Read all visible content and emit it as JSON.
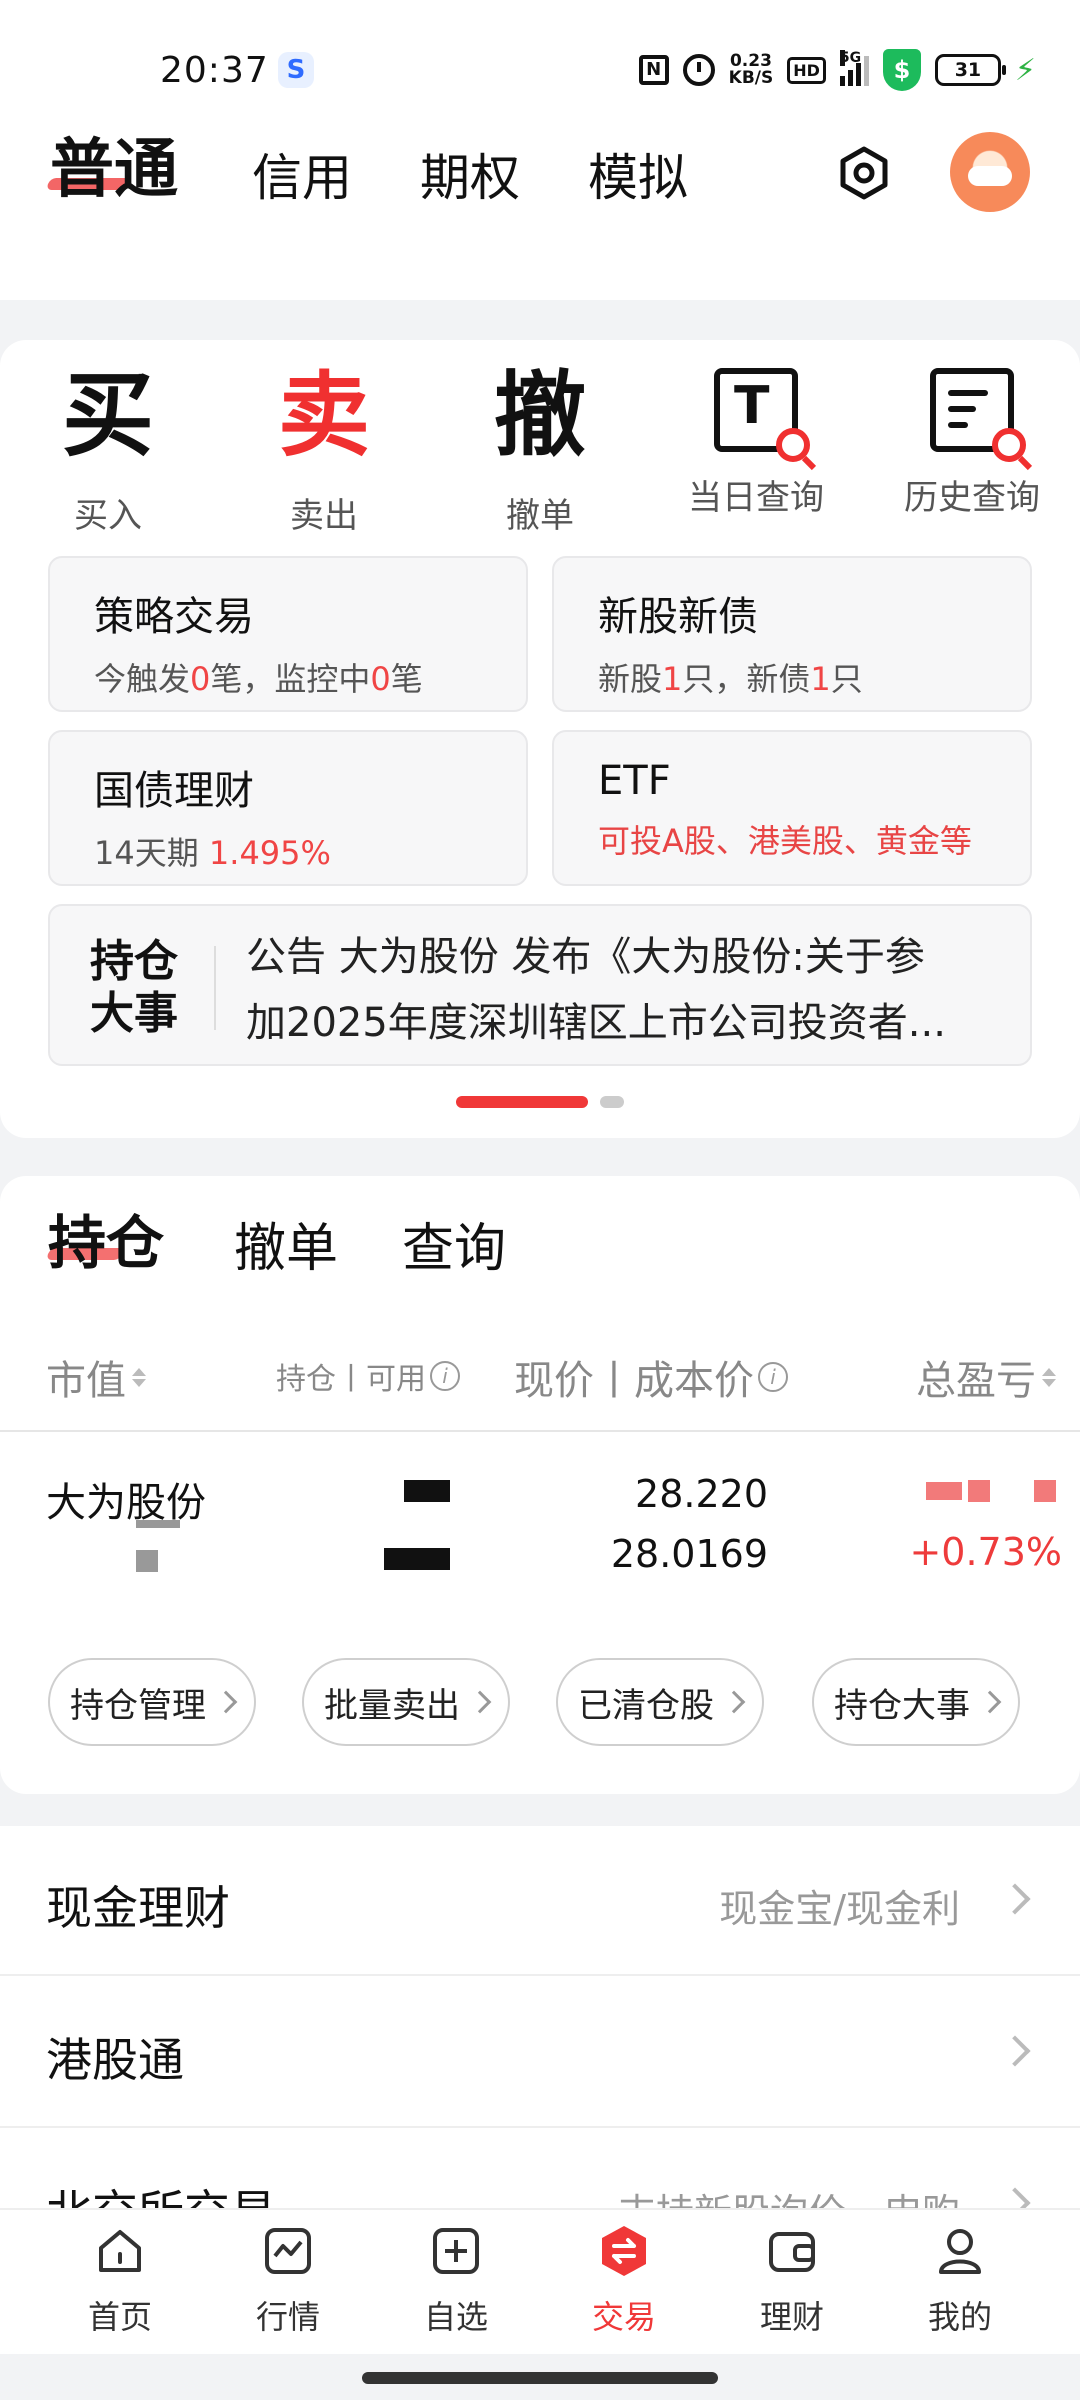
{
  "status_bar": {
    "time": "20:37",
    "app_badge": "S",
    "speed_top": "0.23",
    "speed_bottom": "KB/S",
    "hd": "HD",
    "network": "5G",
    "battery": "31"
  },
  "top_tabs": {
    "active": "普通",
    "tabs": [
      "信用",
      "期权",
      "模拟"
    ]
  },
  "quick_actions": [
    {
      "label": "买入",
      "icon": "buy-icon"
    },
    {
      "label": "卖出",
      "icon": "sell-icon"
    },
    {
      "label": "撤单",
      "icon": "cancel-order-icon"
    },
    {
      "label": "当日查询",
      "icon": "today-query-icon"
    },
    {
      "label": "历史查询",
      "icon": "history-query-icon"
    }
  ],
  "features": {
    "strategy": {
      "title": "策略交易",
      "sub_a": "今触发",
      "num_a": "0",
      "sub_b": "笔，监控中",
      "num_b": "0",
      "sub_c": "笔"
    },
    "ipo": {
      "title": "新股新债",
      "sub_a": "新股",
      "num_a": "1",
      "sub_b": "只，新债",
      "num_b": "1",
      "sub_c": "只"
    },
    "bond": {
      "title": "国债理财",
      "sub_a": "14天期 ",
      "rate": "1.495%"
    },
    "etf": {
      "title": "ETF",
      "sub": "可投A股、港美股、黄金等"
    }
  },
  "news": {
    "badge_line1": "持仓",
    "badge_line2": "大事",
    "line1": "公告 大为股份 发布《大为股份:关于参",
    "line2": "加2025年度深圳辖区上市公司投资者..."
  },
  "holdings": {
    "tabs": {
      "active": "持仓",
      "cancel": "撤单",
      "query": "查询"
    },
    "headers": {
      "market_value": "市值",
      "position": "持仓丨可用",
      "price": "现价丨成本价",
      "pnl": "总盈亏"
    },
    "rows": [
      {
        "name": "大为股份",
        "price": "28.220",
        "cost": "28.0169",
        "pnl_pct": "+0.73%"
      }
    ],
    "chips": [
      "持仓管理",
      "批量卖出",
      "已清仓股",
      "持仓大事"
    ]
  },
  "list": [
    {
      "title": "现金理财",
      "sub": "现金宝/现金利"
    },
    {
      "title": "港股通",
      "sub": ""
    },
    {
      "title": "北交所交易",
      "sub": "支持新股询价、申购"
    }
  ],
  "bottom_nav": [
    {
      "label": "首页",
      "icon": "home-icon"
    },
    {
      "label": "行情",
      "icon": "market-icon"
    },
    {
      "label": "自选",
      "icon": "watchlist-icon"
    },
    {
      "label": "交易",
      "icon": "trade-icon",
      "active": true
    },
    {
      "label": "理财",
      "icon": "wallet-icon"
    },
    {
      "label": "我的",
      "icon": "profile-icon"
    }
  ],
  "colors": {
    "accent": "#f03838",
    "gain": "#ee3b3b",
    "shield": "#1dbb5c"
  }
}
